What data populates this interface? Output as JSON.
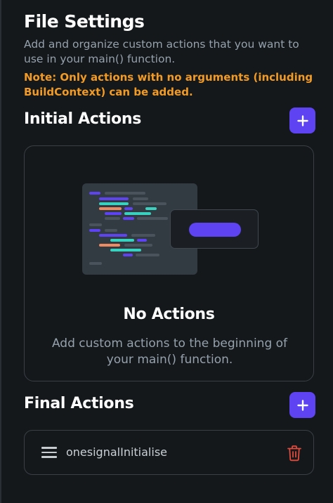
{
  "header": {
    "title": "File Settings",
    "subtitle": "Add and organize custom actions that you want to use in your main() function.",
    "note": "Note: Only actions with no arguments (including BuildContext) can be added."
  },
  "initial_actions": {
    "title": "Initial Actions",
    "add_icon": "plus-icon",
    "empty_title": "No Actions",
    "empty_desc": "Add custom actions to the beginning of your main() function."
  },
  "final_actions": {
    "title": "Final Actions",
    "add_icon": "plus-icon",
    "items": [
      {
        "label": "onesignalInitialise",
        "drag_icon": "drag-handle-icon",
        "delete_icon": "trash-icon"
      }
    ]
  },
  "colors": {
    "background": "#14181b",
    "accent": "#5d43f2",
    "warning": "#f19b26",
    "delete": "#e0493b",
    "secondary_text": "#95a1ac"
  }
}
